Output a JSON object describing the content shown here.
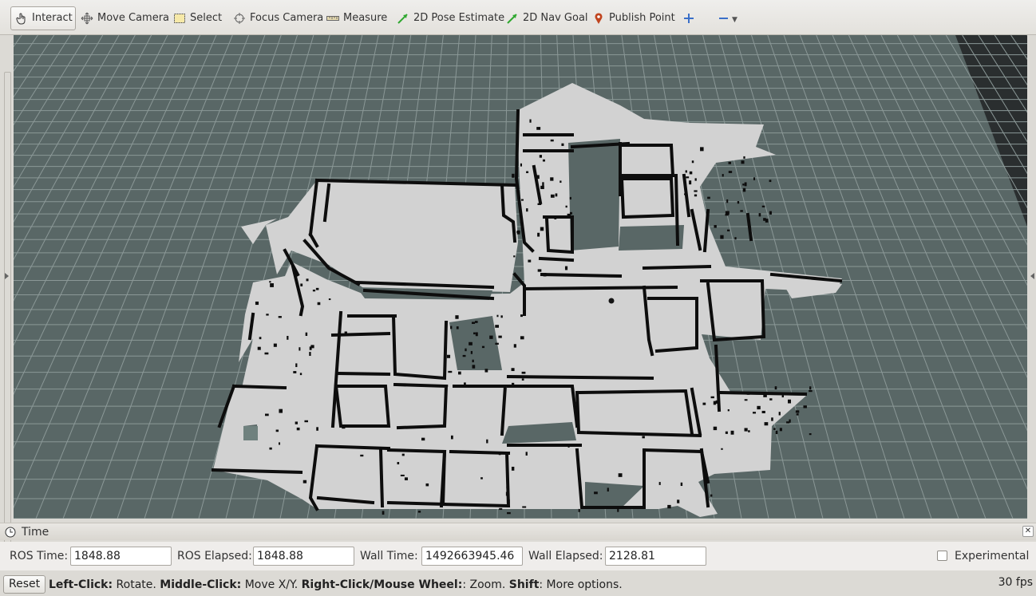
{
  "toolbar": {
    "items": [
      {
        "label": "Interact",
        "icon": "hand-pointer-icon"
      },
      {
        "label": "Move Camera",
        "icon": "move-camera-icon"
      },
      {
        "label": "Select",
        "icon": "select-box-icon"
      },
      {
        "label": "Focus Camera",
        "icon": "focus-target-icon"
      },
      {
        "label": "Measure",
        "icon": "ruler-icon"
      },
      {
        "label": "2D Pose Estimate",
        "icon": "green-arrow-icon"
      },
      {
        "label": "2D Nav Goal",
        "icon": "green-arrow-icon"
      },
      {
        "label": "Publish Point",
        "icon": "map-pin-icon"
      }
    ],
    "add_tool_icon": "plus-icon",
    "remove_tool_icon": "minus-icon"
  },
  "time_panel": {
    "title": "Time",
    "ros_time_label": "ROS Time:",
    "ros_time": "1848.88",
    "ros_elapsed_label": "ROS Elapsed:",
    "ros_elapsed": "1848.88",
    "wall_time_label": "Wall Time:",
    "wall_time": "1492663945.46",
    "wall_elapsed_label": "Wall Elapsed:",
    "wall_elapsed": "2128.81",
    "experimental_label": "Experimental",
    "experimental_checked": false
  },
  "status": {
    "reset_label": "Reset",
    "h1_key": "Left-Click:",
    "h1_val": " Rotate. ",
    "h2_key": "Middle-Click:",
    "h2_val": " Move X/Y. ",
    "h3_key": "Right-Click/Mouse Wheel:",
    "h3_val": ": Zoom. ",
    "h4_key": "Shift",
    "h4_val": ": More options.",
    "fps": "30 fps"
  },
  "colors": {
    "viewport_bg": "#596766",
    "map_free": "#d2d2d2",
    "map_wall": "#0d0d0d",
    "grid_line": "#8b9897"
  }
}
